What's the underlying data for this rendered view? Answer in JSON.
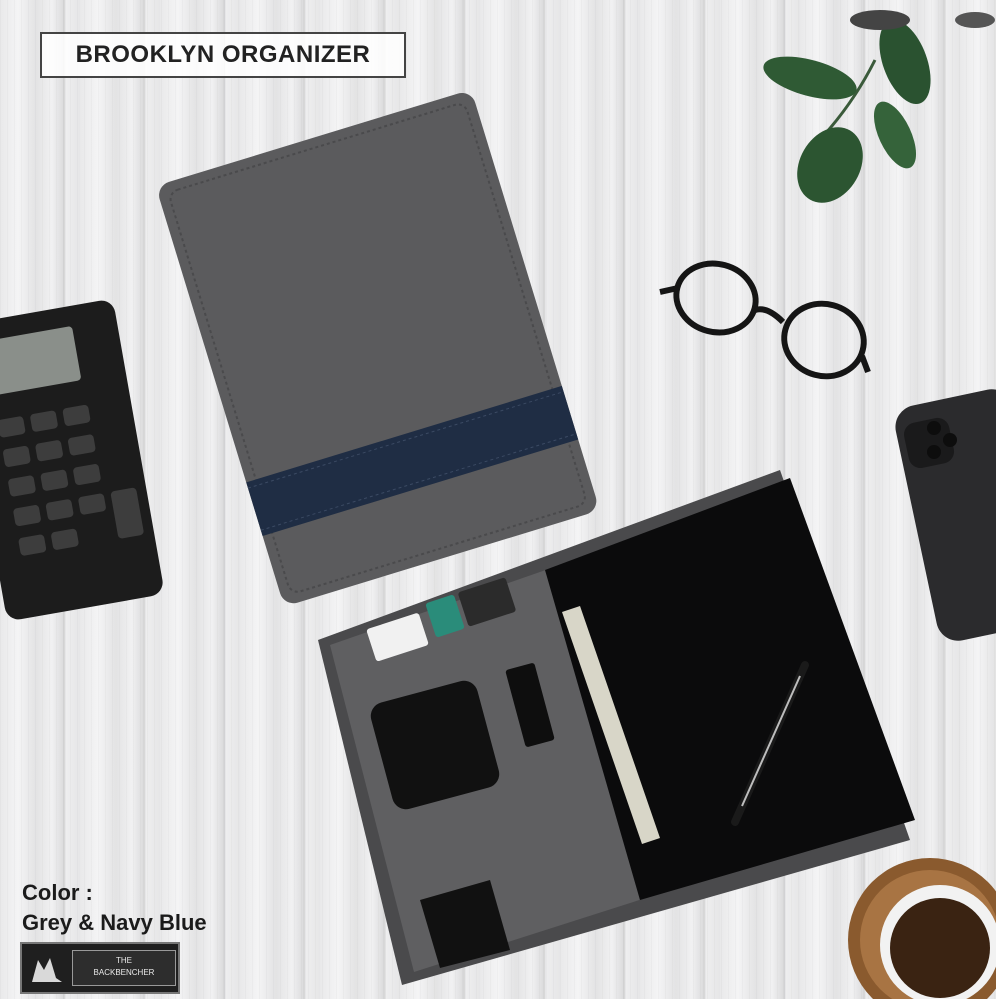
{
  "product": {
    "title": "BROOKLYN ORGANIZER",
    "color_label": "Color :",
    "color_value": "Grey & Navy Blue"
  },
  "brand": {
    "line1": "THE",
    "line2": "BACKBENCHER"
  },
  "palette": {
    "cover_grey": "#5b5b5d",
    "navy_band": "#1f2d44",
    "inner_black": "#0b0b0c",
    "leaf_green": "#2f5a34"
  }
}
